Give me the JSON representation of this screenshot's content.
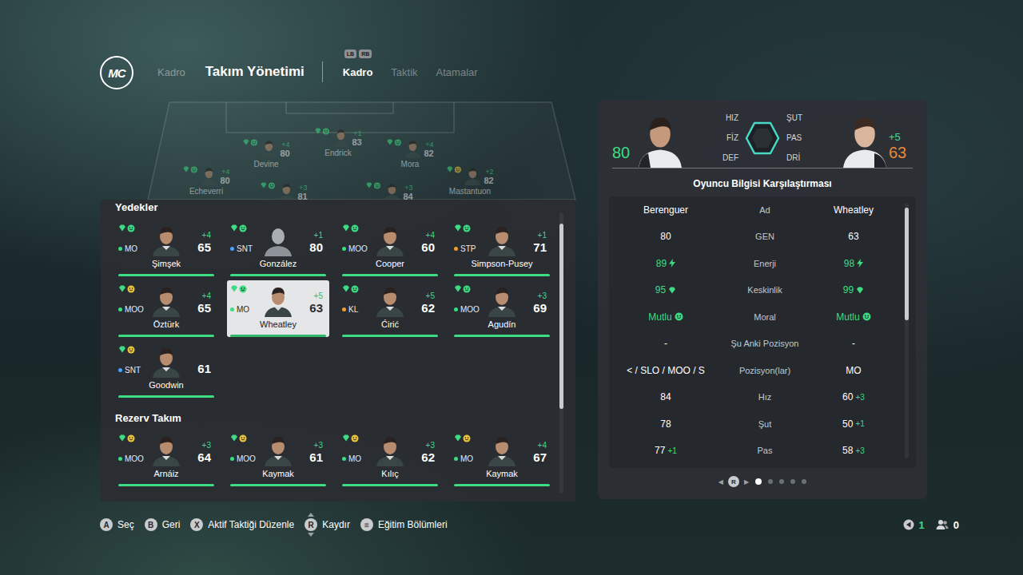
{
  "logo": "MC",
  "nav": [
    {
      "label": "Kadro",
      "selected": false
    },
    {
      "label": "Takım Yönetimi",
      "selected": true
    }
  ],
  "bumpers": [
    "LB",
    "RB"
  ],
  "subtabs": [
    {
      "label": "Kadro",
      "selected": true
    },
    {
      "label": "Taktik",
      "selected": false
    },
    {
      "label": "Atamalar",
      "selected": false
    }
  ],
  "pitch": [
    {
      "name": "Devine",
      "plus": "+4",
      "ovr": "80",
      "moodColor": "#3ddc84"
    },
    {
      "name": "Endrick",
      "plus": "+1",
      "ovr": "83",
      "moodColor": "#3ddc84"
    },
    {
      "name": "Mora",
      "plus": "+4",
      "ovr": "82",
      "moodColor": "#3ddc84"
    },
    {
      "name": "Echeverri",
      "plus": "+4",
      "ovr": "80",
      "moodColor": "#3ddc84"
    },
    {
      "name": "",
      "plus": "+3",
      "ovr": "81",
      "moodColor": "#3ddc84"
    },
    {
      "name": "",
      "plus": "+3",
      "ovr": "84",
      "moodColor": "#3ddc84"
    },
    {
      "name": "Mastantuon",
      "plus": "+2",
      "ovr": "82",
      "moodColor": "#e8c43a"
    }
  ],
  "sections": [
    {
      "title": "Yedekler",
      "players": [
        {
          "name": "Şimşek",
          "pos": "MO",
          "posColor": "#3ddc84",
          "plus": "+4",
          "ovr": "65",
          "moodColor": "#3ddc84",
          "photo": true,
          "selected": false,
          "level": 1
        },
        {
          "name": "González",
          "pos": "SNT",
          "posColor": "#4aa3ff",
          "plus": "+1",
          "ovr": "80",
          "moodColor": "#3ddc84",
          "photo": false,
          "selected": false,
          "level": 1
        },
        {
          "name": "Cooper",
          "pos": "MOO",
          "posColor": "#3ddc84",
          "plus": "+4",
          "ovr": "60",
          "moodColor": "#3ddc84",
          "photo": true,
          "selected": false,
          "level": 1
        },
        {
          "name": "Simpson-Pusey",
          "pos": "STP",
          "posColor": "#f0a030",
          "plus": "+1",
          "ovr": "71",
          "moodColor": "#3ddc84",
          "photo": true,
          "selected": false,
          "level": 1
        },
        {
          "name": "Öztürk",
          "pos": "MOO",
          "posColor": "#3ddc84",
          "plus": "+4",
          "ovr": "65",
          "moodColor": "#e8c43a",
          "photo": true,
          "selected": false,
          "level": 1
        },
        {
          "name": "Wheatley",
          "pos": "MO",
          "posColor": "#3ddc84",
          "plus": "+5",
          "ovr": "63",
          "moodColor": "#3ddc84",
          "photo": true,
          "selected": true,
          "level": 1
        },
        {
          "name": "Ćirić",
          "pos": "KL",
          "posColor": "#f0a030",
          "plus": "+5",
          "ovr": "62",
          "moodColor": "#3ddc84",
          "photo": true,
          "selected": false,
          "level": 1
        },
        {
          "name": "Agudín",
          "pos": "MOO",
          "posColor": "#3ddc84",
          "plus": "+3",
          "ovr": "69",
          "moodColor": "#3ddc84",
          "photo": true,
          "selected": false,
          "level": 1
        },
        {
          "name": "Goodwin",
          "pos": "SNT",
          "posColor": "#4aa3ff",
          "plus": "",
          "ovr": "61",
          "moodColor": "#e8c43a",
          "photo": true,
          "selected": false,
          "level": 1
        }
      ]
    },
    {
      "title": "Rezerv Takım",
      "players": [
        {
          "name": "Arnáiz",
          "pos": "MOO",
          "posColor": "#3ddc84",
          "plus": "+3",
          "ovr": "64",
          "moodColor": "#e8c43a",
          "photo": true,
          "selected": false,
          "level": 1
        },
        {
          "name": "Kaymak",
          "pos": "MOO",
          "posColor": "#3ddc84",
          "plus": "+3",
          "ovr": "61",
          "moodColor": "#e8c43a",
          "photo": true,
          "selected": false,
          "level": 1
        },
        {
          "name": "Kılıç",
          "pos": "MO",
          "posColor": "#3ddc84",
          "plus": "+3",
          "ovr": "62",
          "moodColor": "#e8c43a",
          "photo": true,
          "selected": false,
          "level": 1
        },
        {
          "name": "Kaymak",
          "pos": "MO",
          "posColor": "#3ddc84",
          "plus": "+4",
          "ovr": "67",
          "moodColor": "#e8c43a",
          "photo": true,
          "selected": false,
          "level": 1
        }
      ]
    }
  ],
  "benchScroll": {
    "offset": 0.04,
    "level": 0.66
  },
  "compare": {
    "left": {
      "ovr": "80",
      "plus": "",
      "color": "#3ddc84"
    },
    "right": {
      "ovr": "63",
      "plus": "+5",
      "color": "#e8883a"
    },
    "radarLeft": [
      "HIZ",
      "FİZ",
      "DEF"
    ],
    "radarRight": [
      "ŞUT",
      "PAS",
      "DRİ"
    ],
    "title": "Oyuncu Bilgisi Karşılaştırması",
    "columns": {
      "left": "Berenguer",
      "label": "Ad",
      "right": "Wheatley"
    },
    "rows": [
      {
        "label": "GEN",
        "kind": "plain",
        "left": "80",
        "leftPlus": "",
        "right": "63",
        "rightPlus": ""
      },
      {
        "label": "Enerji",
        "kind": "energy",
        "left": "89",
        "leftPlus": "",
        "right": "98",
        "rightPlus": ""
      },
      {
        "label": "Keskinlik",
        "kind": "sharpness",
        "left": "95",
        "leftPlus": "",
        "right": "99",
        "rightPlus": ""
      },
      {
        "label": "Moral",
        "kind": "morale",
        "left": "Mutlu",
        "leftPlus": "",
        "right": "Mutlu",
        "rightPlus": ""
      },
      {
        "label": "Şu Anki Pozisyon",
        "kind": "plain",
        "left": "-",
        "leftPlus": "",
        "right": "-",
        "rightPlus": ""
      },
      {
        "label": "Pozisyon(lar)",
        "kind": "plain",
        "left": "< / SLO / MOO / S",
        "leftPlus": "",
        "right": "MO",
        "rightPlus": ""
      },
      {
        "label": "Hız",
        "kind": "plain",
        "left": "84",
        "leftPlus": "",
        "right": "60",
        "rightPlus": "+3"
      },
      {
        "label": "Şut",
        "kind": "plain",
        "left": "78",
        "leftPlus": "",
        "right": "50",
        "rightPlus": "+1"
      },
      {
        "label": "Pas",
        "kind": "plain",
        "left": "77",
        "leftPlus": "+1",
        "right": "58",
        "rightPlus": "+3"
      }
    ],
    "scroll": {
      "offset": 0.02,
      "level": 0.44
    },
    "pager": {
      "prev": "◀",
      "key": "R",
      "next": "▶",
      "pages": [
        {
          "selected": true
        },
        {
          "selected": false
        },
        {
          "selected": false
        },
        {
          "selected": false
        },
        {
          "selected": false
        }
      ]
    }
  },
  "hints": [
    {
      "key": "A",
      "label": "Seç",
      "kind": "button"
    },
    {
      "key": "B",
      "label": "Geri",
      "kind": "button"
    },
    {
      "key": "X",
      "label": "Aktif Taktiği Düzenle",
      "kind": "button"
    },
    {
      "key": "R",
      "label": "Kaydır",
      "kind": "stick"
    },
    {
      "key": "≡",
      "label": "Eğitim Bölümleri",
      "kind": "button"
    }
  ],
  "status": [
    {
      "value": "1",
      "kind": "voice",
      "color": "#3ddc84"
    },
    {
      "value": "0",
      "kind": "players",
      "color": "#ffffff"
    }
  ]
}
